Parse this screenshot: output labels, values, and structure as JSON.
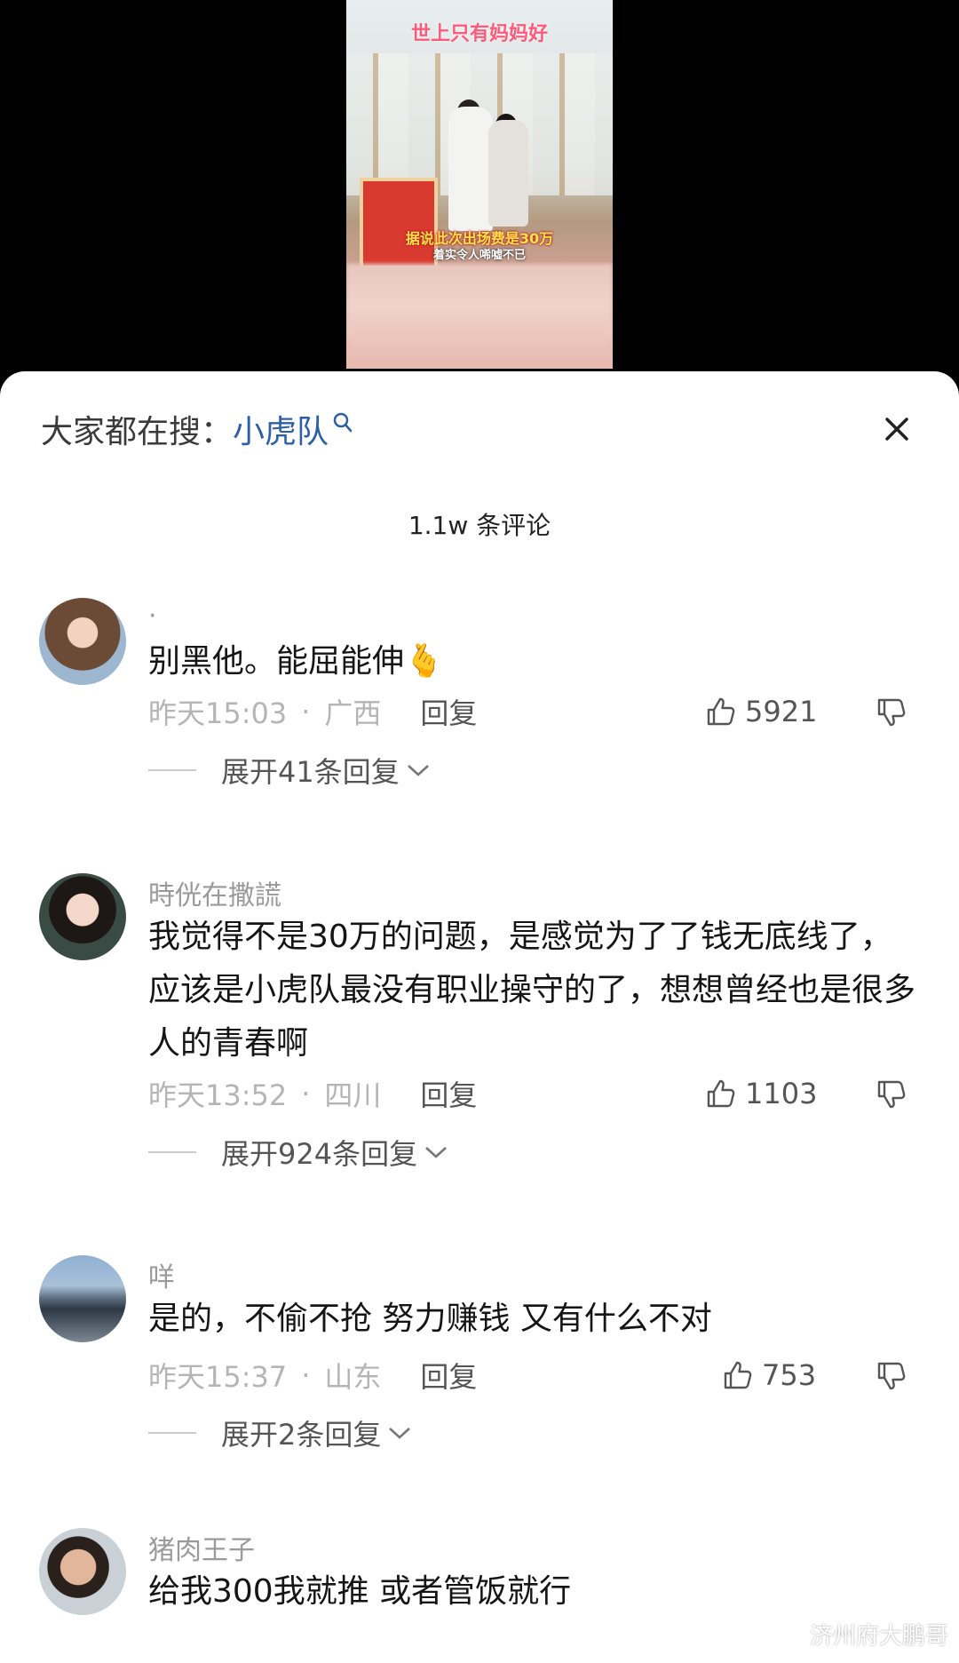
{
  "video": {
    "caption_top": "世上只有妈妈好",
    "caption_line1": "据说此次出场费是30万",
    "caption_line2": "着实令人唏嘘不已"
  },
  "header": {
    "search_prefix": "大家都在搜：",
    "search_keyword": "小虎队",
    "comment_count": "1.1w 条评论"
  },
  "comments": [
    {
      "username": "·",
      "text": "别黑他。能屈能伸🫰",
      "time": "昨天15:03",
      "location": "广西",
      "reply_label": "回复",
      "likes": "5921",
      "expand_label": "展开41条回复"
    },
    {
      "username": "時侊在撒謊",
      "text": "我觉得不是30万的问题，是感觉为了了钱无底线了，应该是小虎队最没有职业操守的了，想想曾经也是很多人的青春啊",
      "time": "昨天13:52",
      "location": "四川",
      "reply_label": "回复",
      "likes": "1103",
      "expand_label": "展开924条回复"
    },
    {
      "username": "咩",
      "text": "是的，不偷不抢 努力赚钱 又有什么不对",
      "time": "昨天15:37",
      "location": "山东",
      "reply_label": "回复",
      "likes": "753",
      "expand_label": "展开2条回复"
    },
    {
      "username": "猪肉王子",
      "text": "给我300我就推  或者管饭就行"
    }
  ],
  "watermark": "济州府大鹏哥",
  "colors": {
    "keyword": "#2d5fa7",
    "meta_text": "#b5b5b5",
    "sheet_bg": "#ffffff",
    "top_bg": "#000000"
  },
  "icons": [
    "search-icon",
    "close-icon",
    "thumbs-up-icon",
    "thumbs-down-icon",
    "chevron-down-icon"
  ]
}
